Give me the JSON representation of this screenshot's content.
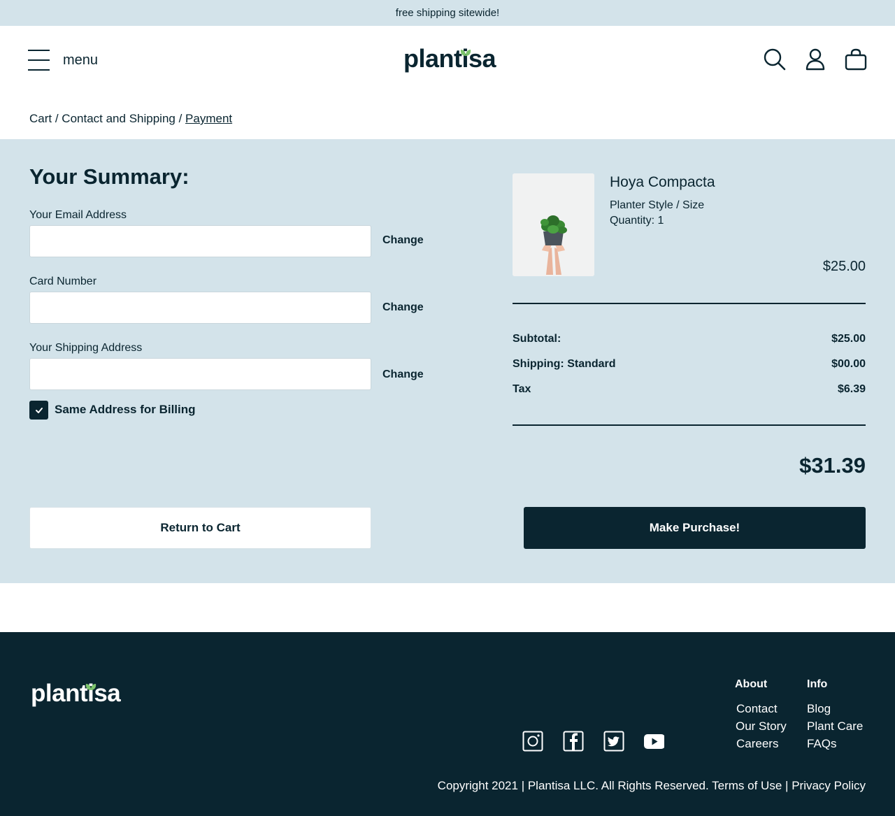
{
  "promo": {
    "text": "free shipping sitewide!"
  },
  "header": {
    "menu_label": "menu",
    "logo_text": "plantisa",
    "icons": [
      "search-icon",
      "account-icon",
      "bag-icon"
    ]
  },
  "breadcrumb": {
    "cart": "Cart",
    "separator": " / ",
    "contact": "Contact and Shipping",
    "payment": "Payment"
  },
  "summary": {
    "title": "Your Summary:",
    "fields": [
      {
        "label": "Your Email Address",
        "value": "",
        "change": "Change"
      },
      {
        "label": "Card Number",
        "value": "",
        "change": "Change"
      },
      {
        "label": "Your Shipping Address",
        "value": "",
        "change": "Change"
      }
    ],
    "billing_checkbox": {
      "label": "Same Address for Billing",
      "checked": true
    },
    "return_button": "Return to Cart",
    "purchase_button": "Make Purchase!"
  },
  "order": {
    "product": {
      "name": "Hoya Compacta",
      "style": "Planter Style / Size",
      "quantity": "Quantity: 1",
      "price": "$25.00"
    },
    "lines": [
      {
        "label": "Subtotal:",
        "value": "$25.00"
      },
      {
        "label": "Shipping: Standard",
        "value": "$00.00"
      },
      {
        "label": "Tax",
        "value": "$6.39"
      }
    ],
    "total": "$31.39"
  },
  "footer": {
    "logo_text": "plantisa",
    "social": [
      "instagram-icon",
      "facebook-icon",
      "twitter-icon",
      "youtube-icon"
    ],
    "about": {
      "title": "About",
      "links": [
        "Contact",
        "Our Story",
        "Careers"
      ]
    },
    "info": {
      "title": "Info",
      "links": [
        "Blog",
        "Plant Care",
        "FAQs"
      ]
    },
    "copyright": "Copyright 2021 | Plantisa LLC. All Rights Reserved.",
    "terms": "Terms of Use",
    "divider": "|",
    "privacy": "Privacy Policy"
  },
  "colors": {
    "primary": "#0a2530",
    "light_bg": "#d3e3ea",
    "leaf_green": "#7cc36b"
  }
}
